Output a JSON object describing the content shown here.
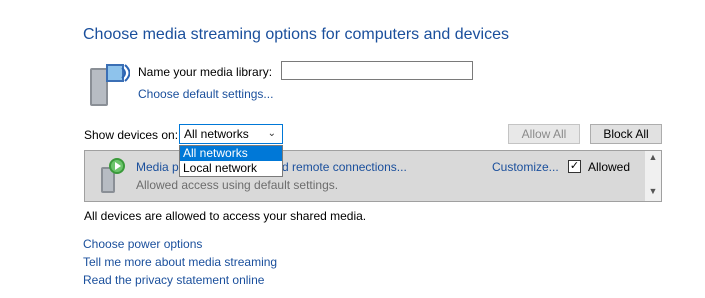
{
  "title": "Choose media streaming options for computers and devices",
  "library": {
    "name_label": "Name your media library:",
    "name_value": "",
    "default_settings_link": "Choose default settings..."
  },
  "show_devices": {
    "label": "Show devices on:",
    "selected": "All networks",
    "options": [
      "All networks",
      "Local network"
    ]
  },
  "buttons": {
    "allow_all": "Allow All",
    "block_all": "Block All"
  },
  "device": {
    "name": "Media p… and remote connections...",
    "name_visible_start": "Media p",
    "name_visible_end": "and remote connections...",
    "status": "Allowed access using default settings.",
    "customize_link": "Customize...",
    "allowed_label": "Allowed",
    "allowed_checked": true
  },
  "info_text": "All devices are allowed to access your shared media.",
  "links": {
    "power": "Choose power options",
    "tell_more": "Tell me more about media streaming",
    "privacy": "Read the privacy statement online"
  },
  "colors": {
    "link": "#1a4f9c",
    "selection": "#0078d7",
    "row_highlight": "#d9d9d9"
  }
}
